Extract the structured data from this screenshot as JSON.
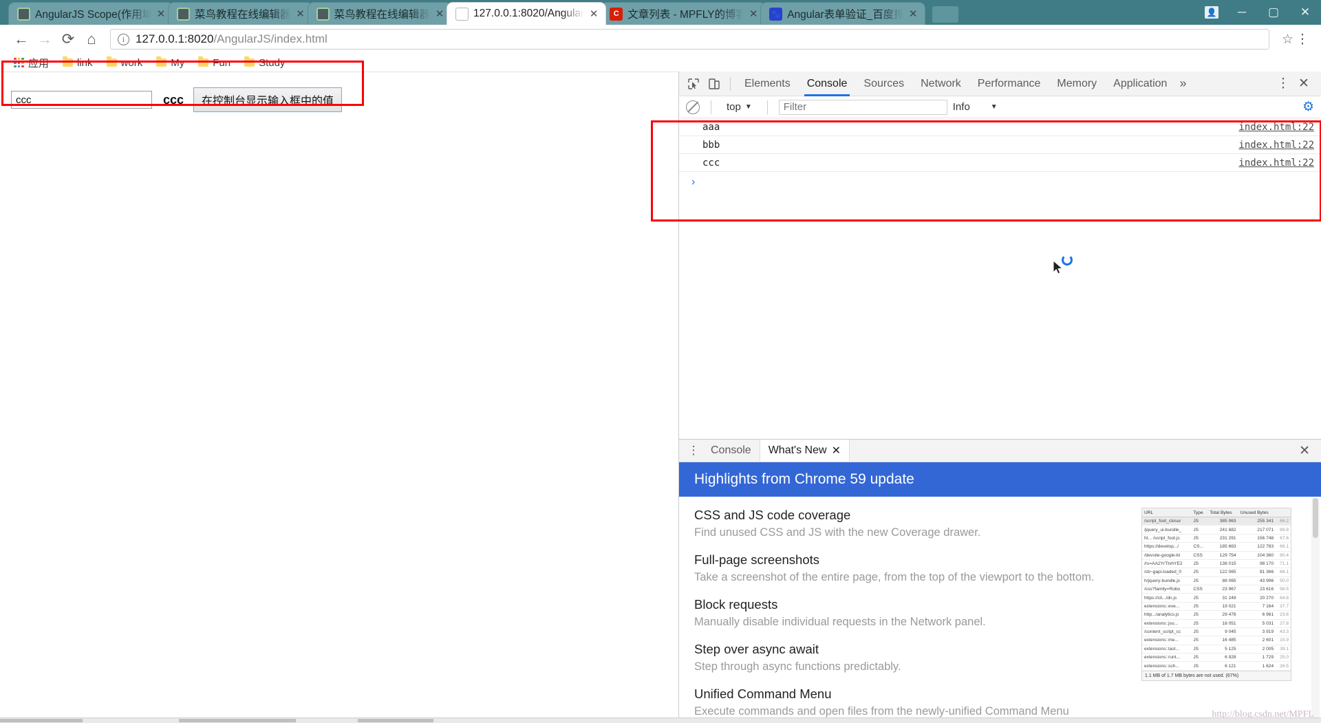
{
  "browser": {
    "tabs": [
      {
        "title": "AngularJS Scope(作用域",
        "favicon": "angularjs-icon",
        "active": false
      },
      {
        "title": "菜鸟教程在线编辑器",
        "favicon": "angularjs-icon",
        "active": false
      },
      {
        "title": "菜鸟教程在线编辑器",
        "favicon": "angularjs-icon",
        "active": false
      },
      {
        "title": "127.0.0.1:8020/Angular",
        "favicon": "document-icon",
        "active": true
      },
      {
        "title": "文章列表 - MPFLY的博客",
        "favicon": "csdn-icon",
        "active": false
      },
      {
        "title": "Angular表单验证_百度搜",
        "favicon": "baidu-icon",
        "active": false
      }
    ],
    "close_label": "✕",
    "window": {
      "minimize": "─",
      "maximize": "▢",
      "close": "✕",
      "account": "user-icon"
    },
    "nav": {
      "back": "←",
      "forward": "→",
      "reload": "⟳",
      "home": "⌂"
    },
    "url": {
      "host": "127.0.0.1:8020",
      "path": "/AngularJS/index.html"
    },
    "star": "☆",
    "menu": "⋮",
    "bookmarks": [
      {
        "label": "应用",
        "icon": "apps-grid-icon"
      },
      {
        "label": "link",
        "icon": "folder-icon"
      },
      {
        "label": "work",
        "icon": "folder-icon"
      },
      {
        "label": "My",
        "icon": "folder-icon"
      },
      {
        "label": "Fun",
        "icon": "folder-icon"
      },
      {
        "label": "Study",
        "icon": "folder-icon"
      }
    ]
  },
  "page": {
    "input_value": "ccc",
    "input_placeholder": "",
    "bound_value": "ccc",
    "button_label": "在控制台显示输入框中的值"
  },
  "devtools": {
    "tabs": [
      "Elements",
      "Console",
      "Sources",
      "Network",
      "Performance",
      "Memory",
      "Application"
    ],
    "selected_tab": "Console",
    "overflow": "»",
    "settings_menu": "⋮",
    "close": "✕",
    "inspect_icon": "inspect-cursor-icon",
    "device_icon": "device-toolbar-icon",
    "console": {
      "clear_icon": "clear-console-icon",
      "context": "top",
      "context_caret": "▼",
      "filter_placeholder": "Filter",
      "level": "Info",
      "level_caret": "▼",
      "settings_icon": "gear-icon",
      "prompt": "›",
      "messages": [
        {
          "text": "aaa",
          "source": "index.html:22"
        },
        {
          "text": "bbb",
          "source": "index.html:22"
        },
        {
          "text": "ccc",
          "source": "index.html:22"
        }
      ]
    },
    "drawer": {
      "menu_icon": "more-options-icon",
      "tabs": [
        {
          "label": "Console",
          "selected": false,
          "closable": false
        },
        {
          "label": "What's New",
          "selected": true,
          "closable": true,
          "close": "✕"
        }
      ],
      "close": "✕",
      "whats_new": {
        "header": "Highlights from Chrome 59 update",
        "items": [
          {
            "title": "CSS and JS code coverage",
            "desc": "Find unused CSS and JS with the new Coverage drawer."
          },
          {
            "title": "Full-page screenshots",
            "desc": "Take a screenshot of the entire page, from the top of the viewport to the bottom."
          },
          {
            "title": "Block requests",
            "desc": "Manually disable individual requests in the Network panel."
          },
          {
            "title": "Step over async await",
            "desc": "Step through async functions predictably."
          },
          {
            "title": "Unified Command Menu",
            "desc": "Execute commands and open files from the newly-unified Command Menu"
          }
        ],
        "thumbnail": {
          "columns": [
            "URL",
            "Type",
            "Total Bytes",
            "Unused Bytes"
          ],
          "rows": [
            [
              "/script_foot_closur",
              "JS",
              "385 963",
              "255 341",
              "66.2"
            ],
            [
              "/jquery_ui-bundle_",
              "JS",
              "241 682",
              "217 071",
              "89.8"
            ],
            [
              "ht... /script_foot.js",
              "JS",
              "231 291",
              "156 748",
              "67.6"
            ],
            [
              "https://develop.../",
              "CS...",
              "185 663",
              "122 783",
              "66.1"
            ],
            [
              "/devsite-google-bl",
              "CSS",
              "129 754",
              "104 360",
              "80.4"
            ],
            [
              "/rs=AA2YrTtvhYE2",
              "JS",
              "138 015",
              "98 170",
              "71.1"
            ],
            [
              "/cb~gapi.loaded_0",
              "JS",
              "122 065",
              "81 366",
              "66.1"
            ],
            [
              "h/jquery-bundle.js",
              "JS",
              "88 065",
              "43 996",
              "50.0"
            ],
            [
              "/css?family=Robo",
              "CSS",
              "23 967",
              "23 616",
              "98.5"
            ],
            [
              "https://cli.../dn.js",
              "JS",
              "31 249",
              "20 270",
              "64.8"
            ],
            [
              "extensions::eve...",
              "JS",
              "19 021",
              "7 164",
              "37.7"
            ],
            [
              "http.../analytics.js",
              "JS",
              "29 478",
              "6 961",
              "23.6"
            ],
            [
              "extensions::jso...",
              "JS",
              "18 051",
              "5 031",
              "27.8"
            ],
            [
              "/content_script_cc",
              "JS",
              "9 045",
              "3 919",
              "43.3"
            ],
            [
              "extensions::me...",
              "JS",
              "16 485",
              "2 601",
              "15.9"
            ],
            [
              "extensions::last...",
              "JS",
              "5 125",
              "2 005",
              "39.1"
            ],
            [
              "extensions::runt...",
              "JS",
              "6 928",
              "1 729",
              "25.0"
            ],
            [
              "extensions::sch...",
              "JS",
              "6 121",
              "1 624",
              "26.5"
            ]
          ],
          "footer": "1.1 MB of 1.7 MB bytes are not used. (67%)"
        }
      }
    }
  },
  "watermark": "http://blog.csdn.net/MPFL",
  "colors": {
    "annotation_red": "#fb0007",
    "accent_blue": "#1a73e8",
    "drawer_header_blue": "#3367d6",
    "tabstrip_teal": "#3f7c86"
  }
}
